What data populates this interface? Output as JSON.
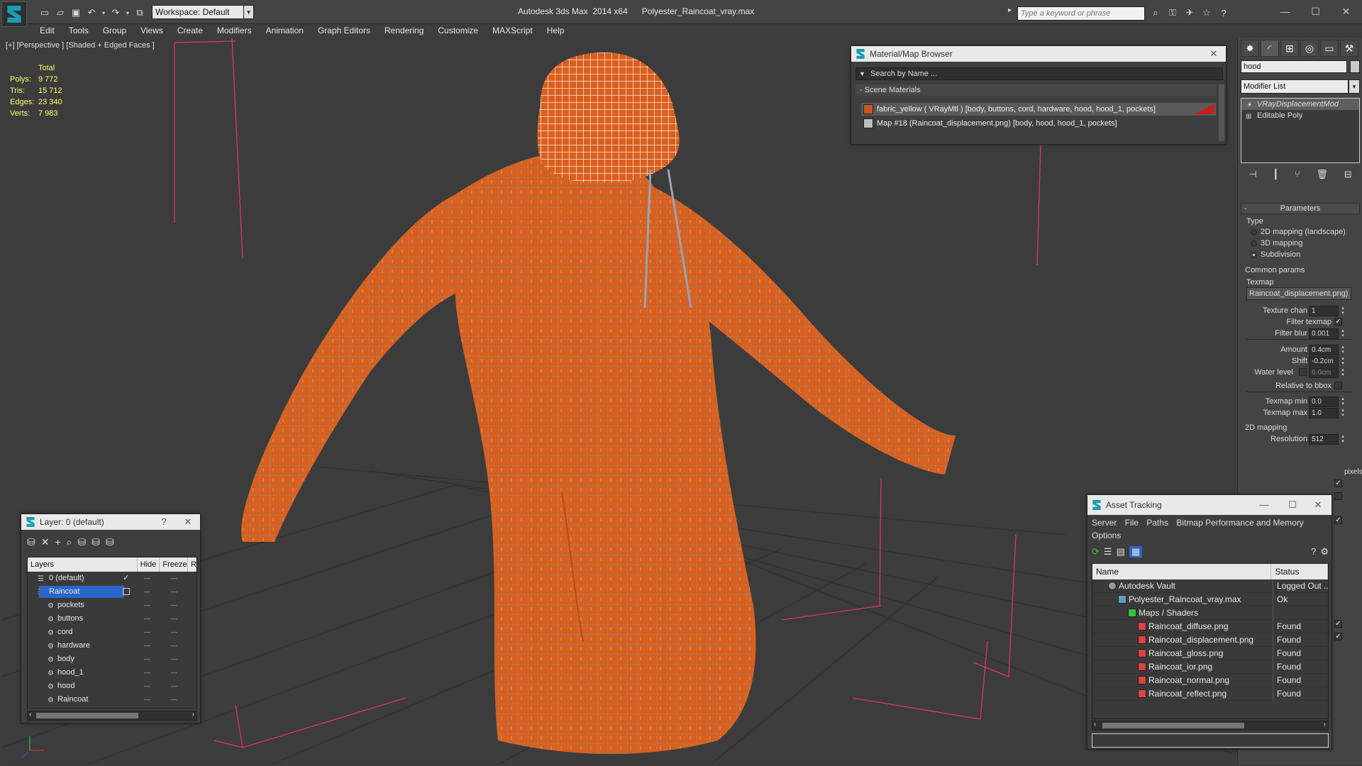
{
  "title_bar": {
    "window_title": "Autodesk 3ds Max  2014 x64      Polyester_Raincoat_vray.max",
    "workspace_label": "Workspace: Default",
    "search_placeholder": "Type a keyword or phrase"
  },
  "menu": [
    "Edit",
    "Tools",
    "Group",
    "Views",
    "Create",
    "Modifiers",
    "Animation",
    "Graph Editors",
    "Rendering",
    "Customize",
    "MAXScript",
    "Help"
  ],
  "viewport": {
    "label": "[+] [Perspective ] [Shaded + Edged Faces ]",
    "stats": {
      "total_label": "Total",
      "rows": [
        {
          "k": "Polys:",
          "v": "9 772"
        },
        {
          "k": "Tris:",
          "v": "15 712"
        },
        {
          "k": "Edges:",
          "v": "23 340"
        },
        {
          "k": "Verts:",
          "v": "7 983"
        }
      ]
    },
    "colors": {
      "coat": "#d9601e",
      "grid": "#2e2e2e",
      "bbox": "#e0307a",
      "wire": "#8a8a8a"
    }
  },
  "command_panel": {
    "object_name": "hood",
    "modifier_list": "Modifier List",
    "stack": [
      "VRayDisplacementMod",
      "Editable Poly"
    ],
    "parameters": {
      "rollout": "Parameters",
      "type_label": "Type",
      "types": [
        "2D mapping (landscape)",
        "3D mapping",
        "Subdivision"
      ],
      "selected_type": "Subdivision",
      "common_params": "Common params",
      "texmap_label": "Texmap",
      "texmap_value": "Raincoat_displacement.png)",
      "texture_chan_label": "Texture chan",
      "texture_chan": "1",
      "filter_texmap_label": "Filter texmap",
      "filter_blur_label": "Filter blur",
      "filter_blur": "0.001",
      "amount_label": "Amount",
      "amount": "0.4cm",
      "shift_label": "Shift",
      "shift": "-0.2cm",
      "water_level_label": "Water level",
      "water_level": "0.0cm",
      "relative_label": "Relative to bbox",
      "texmap_min_label": "Texmap min",
      "texmap_min": "0.0",
      "texmap_max_label": "Texmap max",
      "texmap_max": "1.0",
      "mapping_2d": "2D mapping",
      "resolution_label": "Resolution",
      "resolution": "512",
      "pixels_fragment": "pixels"
    }
  },
  "material_browser": {
    "title": "Material/Map Browser",
    "search_placeholder": "Search by Name ...",
    "section": "- Scene Materials",
    "rows": [
      {
        "label": "fabric_yellow  ( VRayMtl )  [body, buttons, cord, hardware, hood, hood_1, pockets]",
        "swatch": "#c85a20"
      },
      {
        "label": "Map #18 (Raincoat_displacement.png)  [body, hood, hood_1, pockets]",
        "swatch": "#bdbdbd"
      }
    ]
  },
  "layer_window": {
    "title": "Layer: 0 (default)",
    "help": "?",
    "columns": [
      "Layers",
      "Hide",
      "Freeze",
      "R"
    ],
    "rows": [
      {
        "name": "0 (default)",
        "indent": 1,
        "icon": "layer"
      },
      {
        "name": "Raincoat",
        "indent": 1,
        "icon": "layer",
        "selected": true
      },
      {
        "name": "pockets",
        "indent": 2,
        "icon": "object"
      },
      {
        "name": "buttons",
        "indent": 2,
        "icon": "object"
      },
      {
        "name": "cord",
        "indent": 2,
        "icon": "object"
      },
      {
        "name": "hardware",
        "indent": 2,
        "icon": "object"
      },
      {
        "name": "body",
        "indent": 2,
        "icon": "object"
      },
      {
        "name": "hood_1",
        "indent": 2,
        "icon": "object"
      },
      {
        "name": "hood",
        "indent": 2,
        "icon": "object"
      },
      {
        "name": "Raincoat",
        "indent": 2,
        "icon": "object"
      }
    ]
  },
  "asset_tracking": {
    "title": "Asset Tracking",
    "menu": [
      "Server",
      "File",
      "Paths",
      "Bitmap Performance and Memory",
      "Options"
    ],
    "columns": [
      "Name",
      "Status"
    ],
    "rows": [
      {
        "name": "Autodesk Vault",
        "status": "Logged Out ...",
        "indent": 1,
        "icon": "vault"
      },
      {
        "name": "Polyester_Raincoat_vray.max",
        "status": "Ok",
        "indent": 2,
        "icon": "max"
      },
      {
        "name": "Maps / Shaders",
        "status": "",
        "indent": 3,
        "icon": "maps"
      },
      {
        "name": "Raincoat_diffuse.png",
        "status": "Found",
        "indent": 4,
        "icon": "png"
      },
      {
        "name": "Raincoat_displacement.png",
        "status": "Found",
        "indent": 4,
        "icon": "png"
      },
      {
        "name": "Raincoat_gloss.png",
        "status": "Found",
        "indent": 4,
        "icon": "png"
      },
      {
        "name": "Raincoat_ior.png",
        "status": "Found",
        "indent": 4,
        "icon": "png"
      },
      {
        "name": "Raincoat_normal.png",
        "status": "Found",
        "indent": 4,
        "icon": "png"
      },
      {
        "name": "Raincoat_reflect.png",
        "status": "Found",
        "indent": 4,
        "icon": "png"
      }
    ]
  }
}
